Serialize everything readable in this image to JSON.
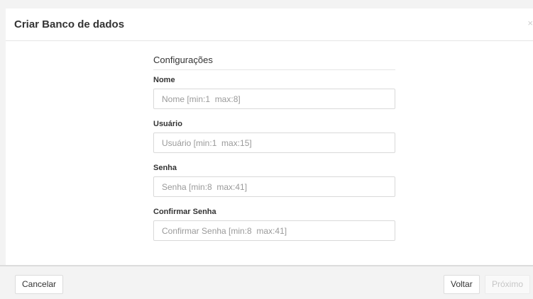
{
  "modal": {
    "title": "Criar Banco de dados",
    "close_glyph": "×"
  },
  "form": {
    "section_title": "Configurações",
    "fields": [
      {
        "label": "Nome",
        "placeholder": "Nome [min:1  max:8]",
        "value": ""
      },
      {
        "label": "Usuário",
        "placeholder": "Usuário [min:1  max:15]",
        "value": ""
      },
      {
        "label": "Senha",
        "placeholder": "Senha [min:8  max:41]",
        "value": ""
      },
      {
        "label": "Confirmar Senha",
        "placeholder": "Confirmar Senha [min:8  max:41]",
        "value": ""
      }
    ]
  },
  "footer": {
    "cancel_label": "Cancelar",
    "back_label": "Voltar",
    "next_label": "Próximo"
  },
  "icons": {
    "close": "close-icon"
  }
}
